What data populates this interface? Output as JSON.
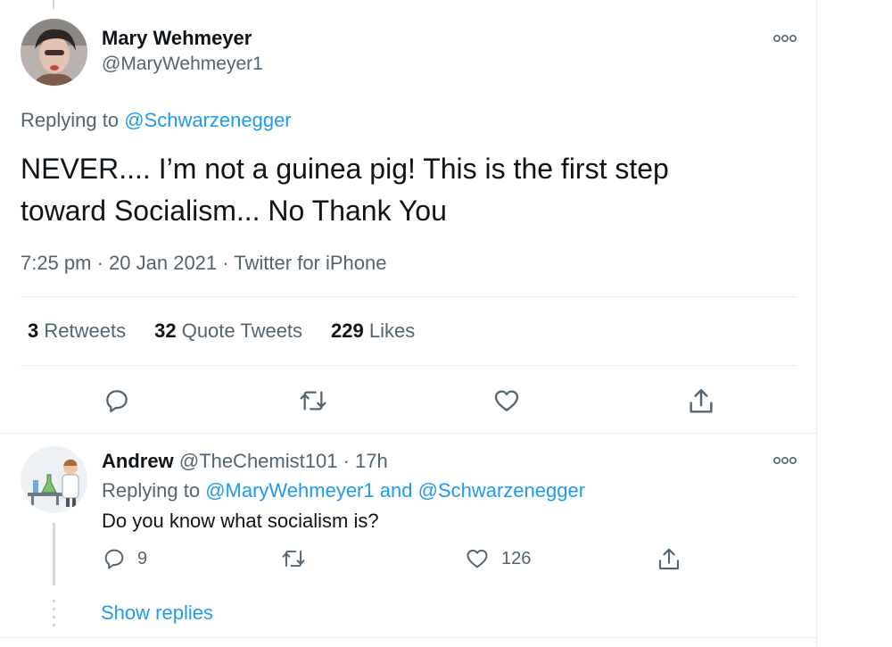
{
  "main_tweet": {
    "author_name": "Mary Wehmeyer",
    "author_handle": "@MaryWehmeyer1",
    "replying_prefix": "Replying to",
    "replying_to": "@Schwarzenegger",
    "text_line1": "NEVER.... I’m not a guinea pig!  This is the first step",
    "text_line2": "toward Socialism... No Thank You",
    "meta": "7:25 pm · 20 Jan 2021 · Twitter for iPhone",
    "retweets_count": "3",
    "retweets_label": "Retweets",
    "quotes_count": "32",
    "quotes_label": "Quote Tweets",
    "likes_count": "229",
    "likes_label": "Likes"
  },
  "reply_tweet": {
    "author_name": "Andrew",
    "author_handle": "@TheChemist101",
    "time": "· 17h",
    "replying_prefix": "Replying to",
    "replying_to_1": "@MaryWehmeyer1",
    "replying_and": "and",
    "replying_to_2": "@Schwarzenegger",
    "text": "Do you know what socialism is?",
    "reply_count": "9",
    "retweet_count": "",
    "like_count": "126",
    "show_replies": "Show replies"
  },
  "icons": [
    "more-icon",
    "reply-icon",
    "retweet-icon",
    "like-icon",
    "share-icon"
  ],
  "colors": {
    "accent": "#1d9bf0",
    "secondary_text": "#536471",
    "primary_text": "#0f1419",
    "divider": "#e6ecf0"
  }
}
